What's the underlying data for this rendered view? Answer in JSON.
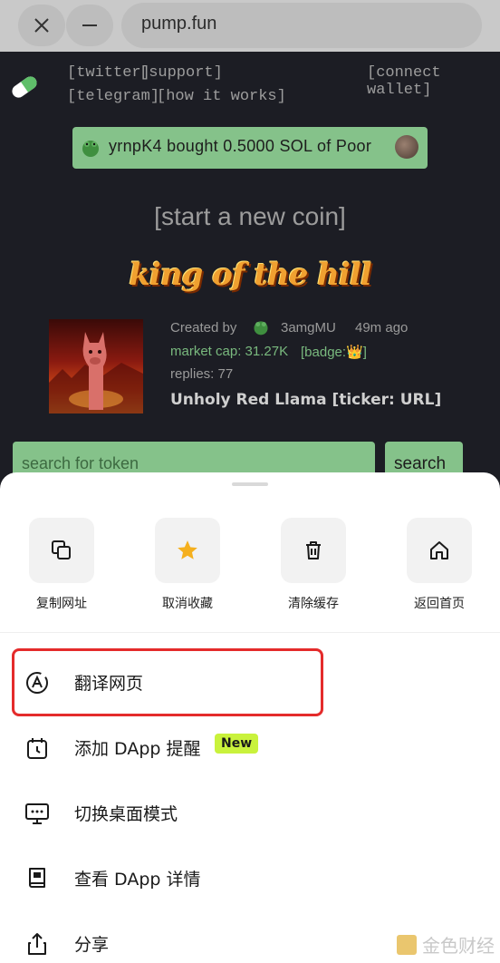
{
  "browser": {
    "url": "pump.fun",
    "close_icon": "close-icon",
    "minimize_icon": "minimize-icon"
  },
  "page": {
    "nav": {
      "twitter": "[twitter]",
      "support": "[support]",
      "telegram": "[telegram]",
      "how_it_works": "[how it works]",
      "connect_wallet": "[connect wallet]"
    },
    "ticker": {
      "text": "yrnpK4  bought 0.5000 SOL of Poor"
    },
    "start_new_coin": "[start a new coin]",
    "king_of_the_hill": "king of the hill",
    "coin": {
      "created_by_label": "Created by",
      "creator": "3amgMU",
      "time_ago": "49m ago",
      "market_cap": "market cap: 31.27K",
      "badge": "[badge:👑]",
      "replies": "replies: 77",
      "name": "Unholy Red Llama [ticker: URL]"
    },
    "search": {
      "placeholder": "search for token",
      "button": "search"
    },
    "colors": {
      "accent_green": "#85c28a",
      "page_bg": "#1c1d24"
    }
  },
  "sheet": {
    "actions": [
      {
        "label": "复制网址",
        "icon": "copy-icon"
      },
      {
        "label": "取消收藏",
        "icon": "star-icon"
      },
      {
        "label": "清除缓存",
        "icon": "trash-icon"
      },
      {
        "label": "返回首页",
        "icon": "home-icon"
      }
    ],
    "menu": [
      {
        "label": "翻译网页",
        "icon": "translate-icon"
      },
      {
        "label": "添加 DApp 提醒",
        "icon": "calendar-reminder-icon",
        "badge": "New"
      },
      {
        "label": "切换桌面模式",
        "icon": "desktop-mode-icon"
      },
      {
        "label": "查看 DApp 详情",
        "icon": "book-icon"
      },
      {
        "label": "分享",
        "icon": "share-icon"
      }
    ],
    "colors": {
      "highlight_border": "#e42b2b",
      "new_badge": "#c9f23c",
      "star": "#f5b01e"
    }
  },
  "watermark": "金色财经"
}
